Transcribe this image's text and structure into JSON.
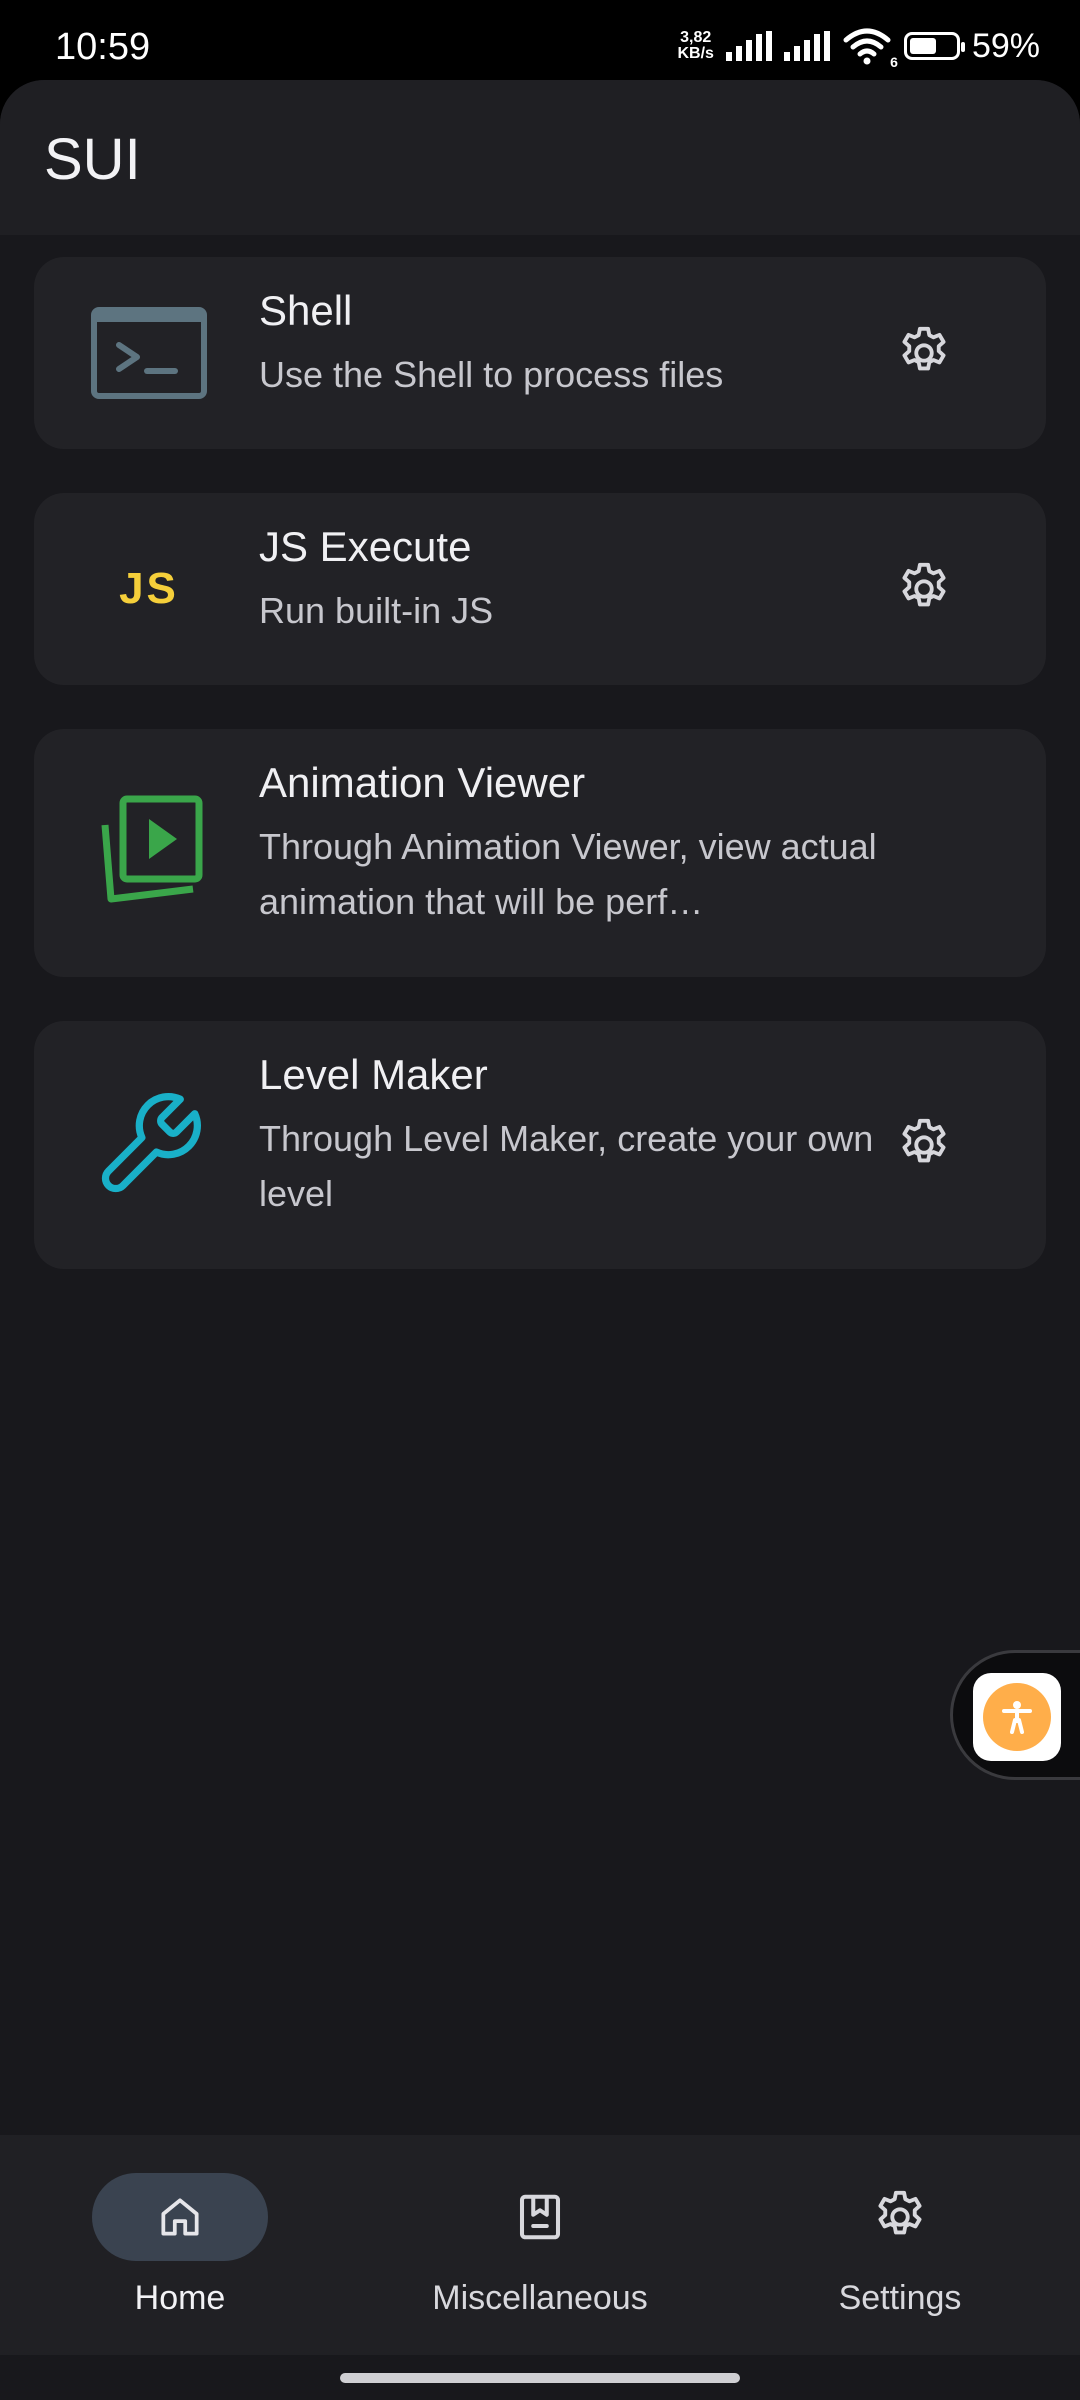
{
  "status_bar": {
    "time": "10:59",
    "speed_value": "3,82",
    "speed_unit": "KB/s",
    "wifi_label": "6",
    "battery_percent_text": "59%",
    "battery_level": 0.59
  },
  "app": {
    "title": "SUI"
  },
  "cards": [
    {
      "title": "Shell",
      "description": "Use the Shell to process files",
      "icon": "terminal-icon",
      "icon_color": "#5d7480",
      "has_settings": true
    },
    {
      "title": "JS Execute",
      "description": "Run built-in JS",
      "icon_text": "JS",
      "icon_color": "#f5cf3a",
      "has_settings": true
    },
    {
      "title": "Animation Viewer",
      "description": "Through Animation Viewer, view actual animation that will be perf…",
      "icon": "animation-icon",
      "icon_color": "#3aa64a",
      "has_settings": false
    },
    {
      "title": "Level Maker",
      "description": "Through Level Maker, create your own level",
      "icon": "wrench-icon",
      "icon_color": "#19b0c8",
      "has_settings": true
    }
  ],
  "bottom_nav": {
    "items": [
      {
        "label": "Home",
        "icon": "home-icon",
        "active": true
      },
      {
        "label": "Miscellaneous",
        "icon": "bookmark-icon",
        "active": false
      },
      {
        "label": "Settings",
        "icon": "gear-icon",
        "active": false
      }
    ]
  },
  "colors": {
    "background": "#18181c",
    "card": "#222226",
    "active_nav_pill": "#3a4350",
    "accessibility_accent": "#ffae4a"
  }
}
